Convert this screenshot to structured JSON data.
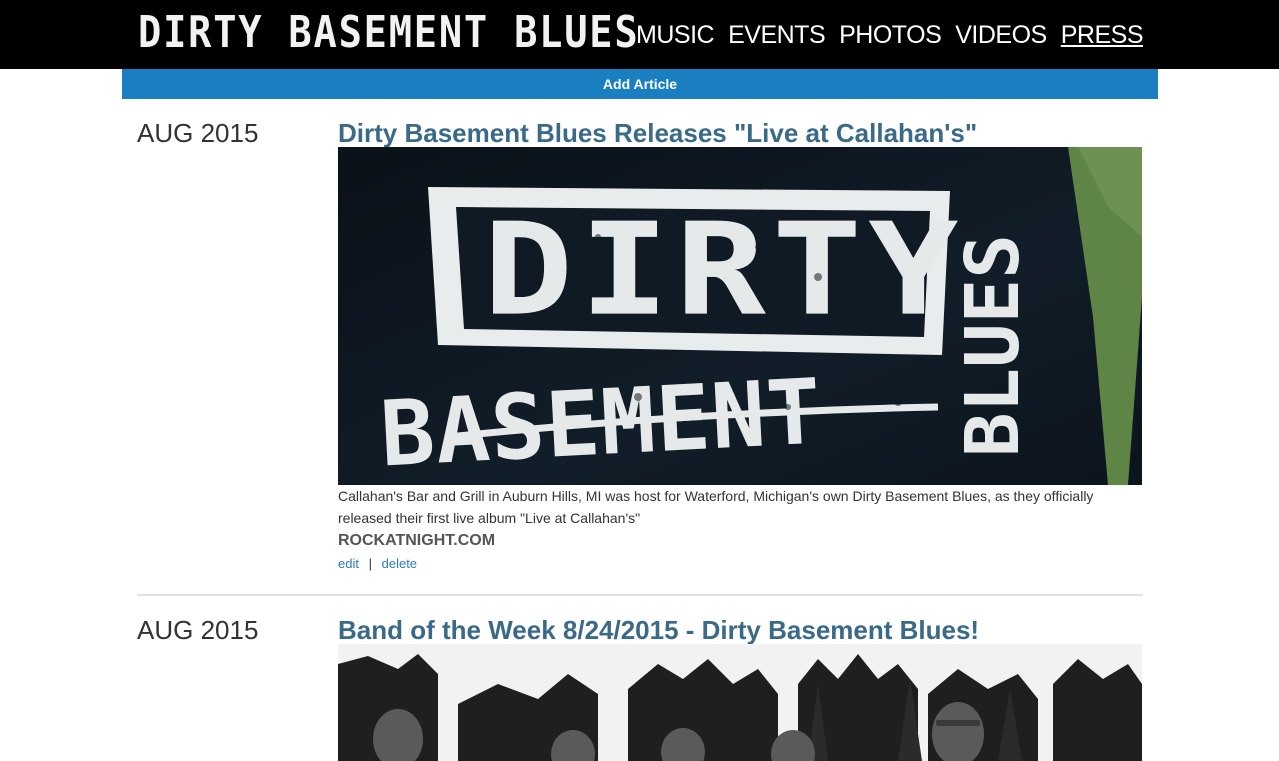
{
  "header": {
    "logo_text": "DIRTY BASEMENT BLUES",
    "nav": [
      {
        "label": "MUSIC",
        "active": false
      },
      {
        "label": "EVENTS",
        "active": false
      },
      {
        "label": "PHOTOS",
        "active": false
      },
      {
        "label": "VIDEOS",
        "active": false
      },
      {
        "label": "PRESS",
        "active": true
      }
    ]
  },
  "toolbar": {
    "add_article_label": "Add Article"
  },
  "articles": [
    {
      "date": "AUG 2015",
      "title": "Dirty Basement Blues Releases \"Live at Callahan's\"",
      "description": "Callahan's Bar and Grill in Auburn Hills, MI was host for Waterford, Michigan's own Dirty Basement Blues, as they officially released their first live album \"Live at Callahan's\"",
      "source": "ROCKATNIGHT.COM",
      "edit_label": "edit",
      "separator": "|",
      "delete_label": "delete",
      "image_text_main": "DIRTY",
      "image_text_sub": "BASEMENT",
      "image_text_side": "BLUES"
    },
    {
      "date": "AUG 2015",
      "title": "Band of the Week 8/24/2015 - Dirty Basement Blues!"
    }
  ],
  "colors": {
    "header_bg": "#000000",
    "accent_blue": "#1a7fc1",
    "title_color": "#3a6a88",
    "link_color": "#2f7bbf"
  }
}
